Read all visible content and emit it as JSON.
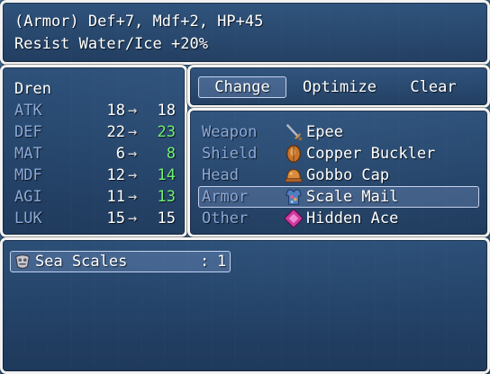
{
  "help": {
    "line1": "(Armor) Def+7, Mdf+2, HP+45",
    "line2": "Resist Water/Ice +20%"
  },
  "status": {
    "actor": "Dren",
    "arrow": "→",
    "params": [
      {
        "name": "ATK",
        "current": "18",
        "new": "18",
        "changed": false
      },
      {
        "name": "DEF",
        "current": "22",
        "new": "23",
        "changed": true
      },
      {
        "name": "MAT",
        "current": "6",
        "new": "8",
        "changed": true
      },
      {
        "name": "MDF",
        "current": "12",
        "new": "14",
        "changed": true
      },
      {
        "name": "AGI",
        "current": "11",
        "new": "13",
        "changed": true
      },
      {
        "name": "LUK",
        "current": "15",
        "new": "15",
        "changed": false
      }
    ]
  },
  "commands": [
    "Change",
    "Optimize",
    "Clear"
  ],
  "slots": [
    {
      "slot": "Weapon",
      "item": "Epee",
      "icon": "sword-icon"
    },
    {
      "slot": "Shield",
      "item": "Copper Buckler",
      "icon": "buckler-icon"
    },
    {
      "slot": "Head",
      "item": "Gobbo Cap",
      "icon": "cap-icon"
    },
    {
      "slot": "Armor",
      "item": "Scale Mail",
      "icon": "scale-mail-icon"
    },
    {
      "slot": "Other",
      "item": "Hidden Ace",
      "icon": "card-icon"
    }
  ],
  "items": [
    {
      "name": "Sea Scales",
      "sep": ":",
      "count": "1",
      "icon": "sea-scales-icon"
    }
  ],
  "colors": {
    "system": "#8aa8d8",
    "increase": "#6ff06f"
  }
}
